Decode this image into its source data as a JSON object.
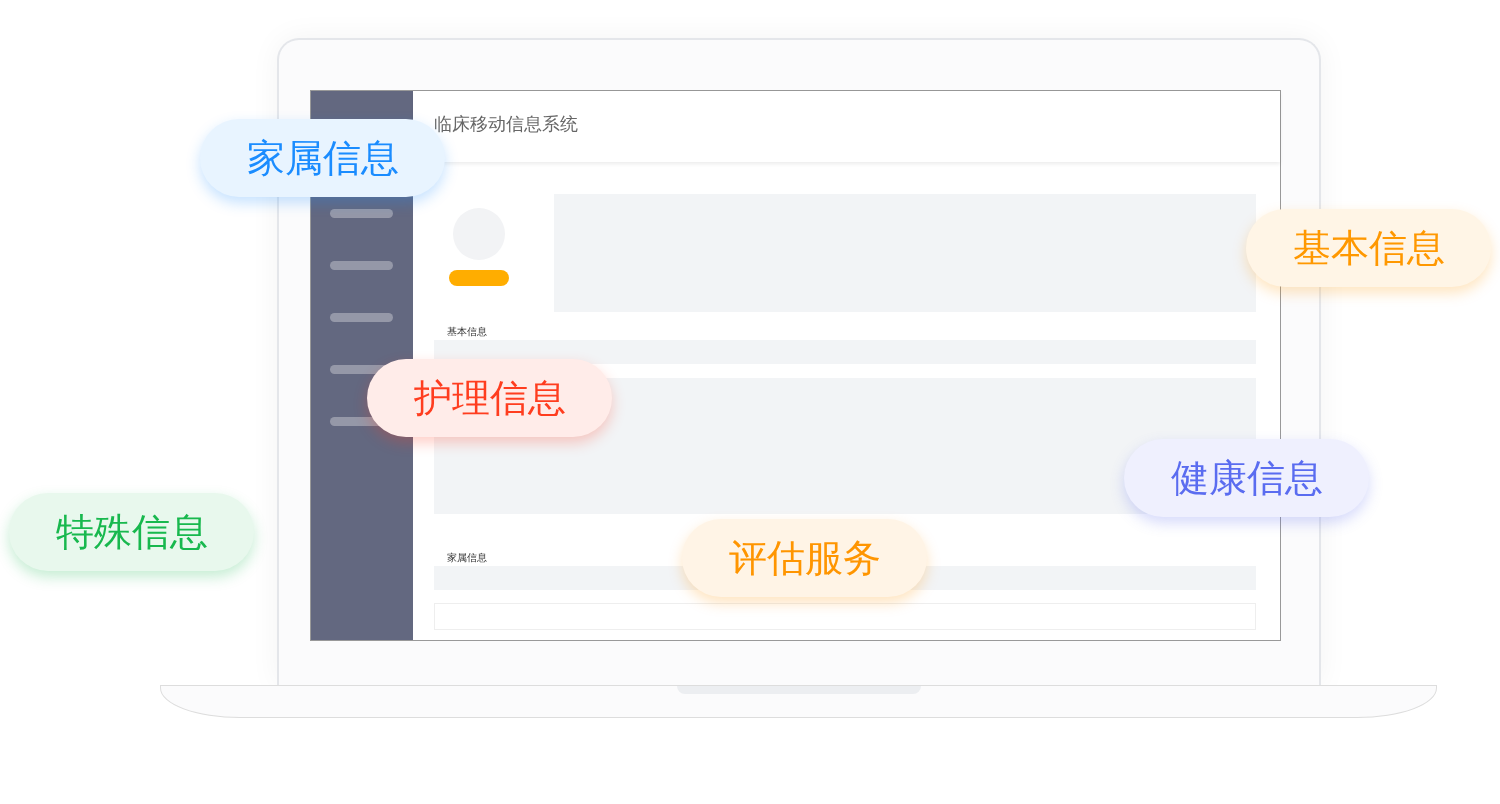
{
  "app": {
    "title": "临床移动信息系统"
  },
  "sections": [
    {
      "label": "基本信息"
    },
    {
      "label": "家属信息"
    }
  ],
  "tags": [
    {
      "text": "家属信息",
      "color": "#1a8cff"
    },
    {
      "text": "基本信息",
      "color": "#ff9800"
    },
    {
      "text": "护理信息",
      "color": "#ff3d1f"
    },
    {
      "text": "健康信息",
      "color": "#5a6cf0"
    },
    {
      "text": "特殊信息",
      "color": "#18b84e"
    },
    {
      "text": "评估服务",
      "color": "#ff9500"
    }
  ]
}
